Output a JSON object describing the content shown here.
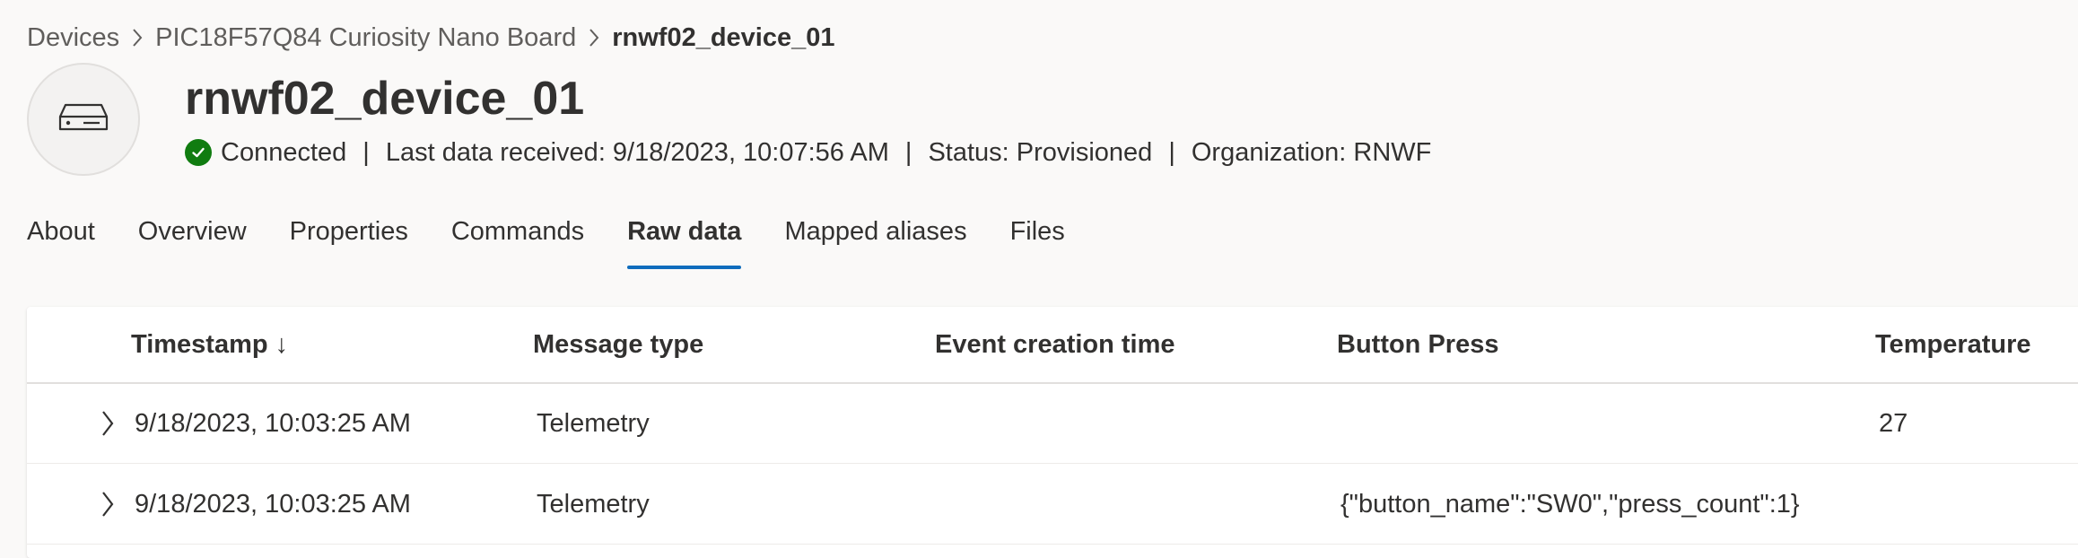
{
  "breadcrumb": {
    "items": [
      "Devices",
      "PIC18F57Q84 Curiosity Nano Board",
      "rnwf02_device_01"
    ]
  },
  "device": {
    "title": "rnwf02_device_01",
    "icon": "device-icon",
    "connection": "Connected",
    "last_data": "Last data received: 9/18/2023, 10:07:56 AM",
    "status": "Status: Provisioned",
    "organization": "Organization: RNWF",
    "separator": "|"
  },
  "tabs": [
    {
      "label": "About"
    },
    {
      "label": "Overview"
    },
    {
      "label": "Properties"
    },
    {
      "label": "Commands"
    },
    {
      "label": "Raw data",
      "active": true
    },
    {
      "label": "Mapped aliases"
    },
    {
      "label": "Files"
    }
  ],
  "table": {
    "columns": [
      "Timestamp ↓",
      "Message type",
      "Event creation time",
      "Button Press",
      "Temperature"
    ],
    "rows": [
      [
        "9/18/2023, 10:03:25 AM",
        "Telemetry",
        "",
        "",
        "27"
      ],
      [
        "9/18/2023, 10:03:25 AM",
        "Telemetry",
        "",
        "{\"button_name\":\"SW0\",\"press_count\":1}",
        ""
      ]
    ]
  },
  "colors": {
    "accent": "#0f6cbd",
    "connected": "#107c10",
    "background": "#faf9f8"
  }
}
